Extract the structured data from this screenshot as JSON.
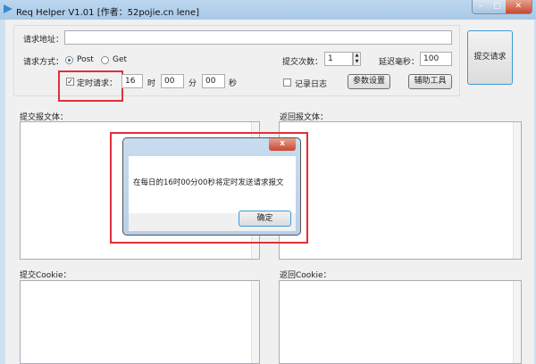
{
  "window": {
    "title": "Req Helper V1.01   [作者：52pojie.cn lene]",
    "min": "–",
    "max": "□",
    "close": "✕"
  },
  "form": {
    "url_label": "请求地址：",
    "url_value": "",
    "method_label": "请求方式：",
    "post": "Post",
    "get": "Get",
    "schedule_label": "定时请求：",
    "hour": "16",
    "hour_unit": "时",
    "minute": "00",
    "minute_unit": "分",
    "second": "00",
    "second_unit": "秒",
    "count_label": "提交次数：",
    "count": "1",
    "delay_label": "延迟毫秒：",
    "delay": "100",
    "log_label": "记录日志",
    "params_button": "参数设置",
    "tools_button": "辅助工具",
    "submit_button": "提交请求"
  },
  "panels": {
    "req_body": "提交报文体：",
    "resp_body": "返回报文体：",
    "req_cookie": "提交Cookie：",
    "resp_cookie": "返回Cookie："
  },
  "dialog": {
    "close": "x",
    "message": "在每日的16时00分00秒将定时发送请求报文",
    "ok": "确定"
  }
}
